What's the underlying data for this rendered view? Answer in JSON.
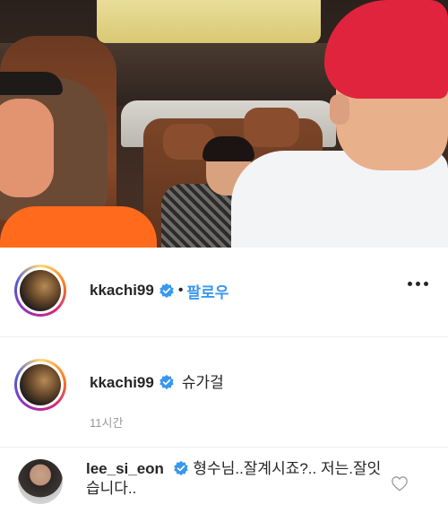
{
  "post": {
    "username": "kkachi99",
    "separator": "•",
    "follow_label": "팔로우"
  },
  "caption": {
    "username": "kkachi99",
    "text": "슈가걸",
    "timestamp": "11시간"
  },
  "comment": {
    "username": "lee_si_eon",
    "text": "형수님..잘계시죠?.. 저는.잘잇습니다.."
  },
  "icons": {
    "verified": "verified-badge-icon",
    "more": "more-options-icon",
    "like": "heart-icon"
  },
  "colors": {
    "follow": "#3897f0",
    "verified": "#3897f0",
    "timestamp": "#999999"
  }
}
